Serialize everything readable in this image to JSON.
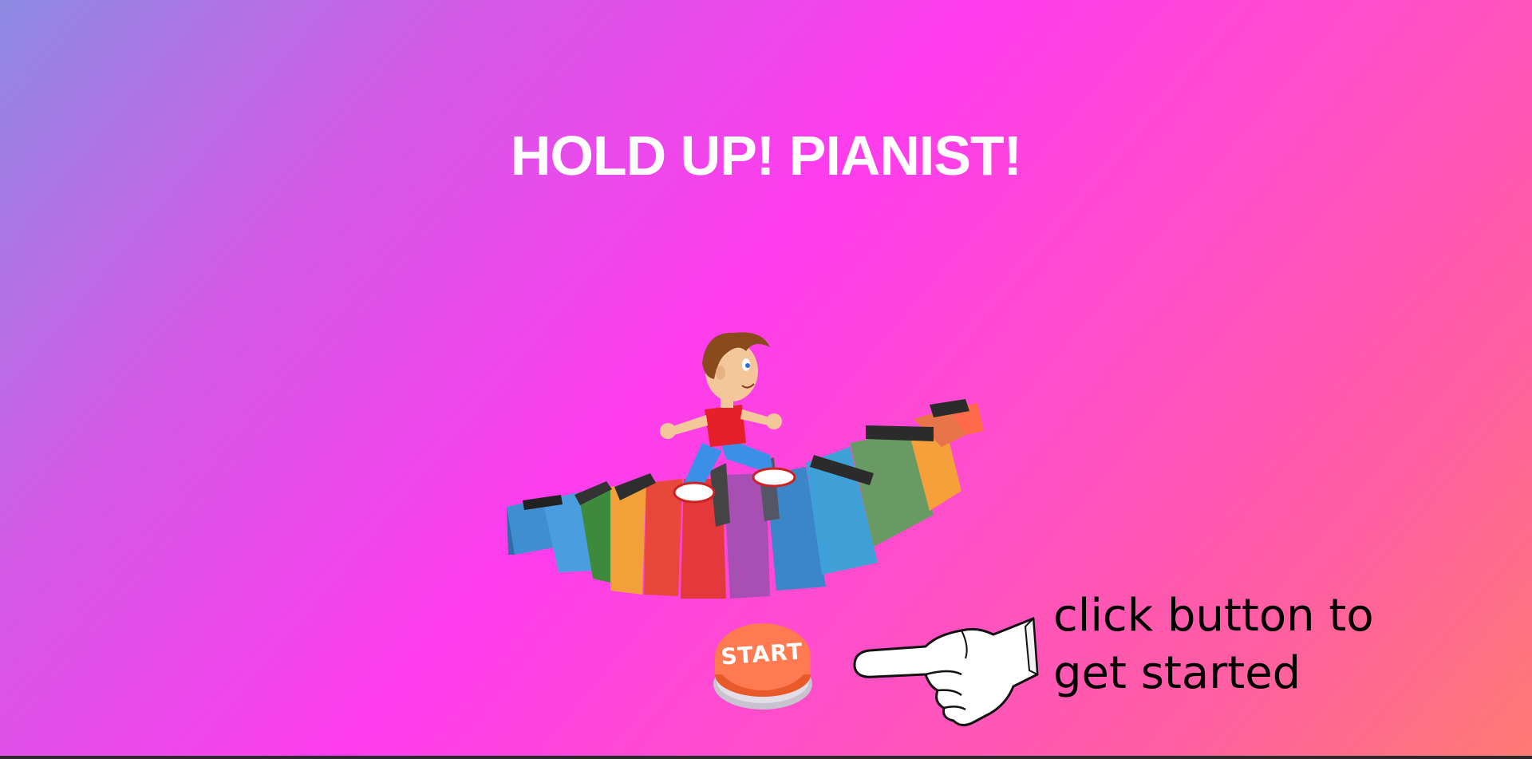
{
  "title": "HOLD UP! PIANIST!",
  "start_button": {
    "label": "START",
    "color": "#ff7a50"
  },
  "hint": {
    "line1": "click button to",
    "line2": "get started"
  },
  "images": {
    "hero": "boy-running-on-rainbow-piano-keys",
    "pointer": "pointing-hand-icon"
  },
  "colors": {
    "gradient_start": "#8d8be4",
    "gradient_mid": "#fe3cee",
    "gradient_end": "#ff7a73",
    "title_text": "#ffffff"
  }
}
